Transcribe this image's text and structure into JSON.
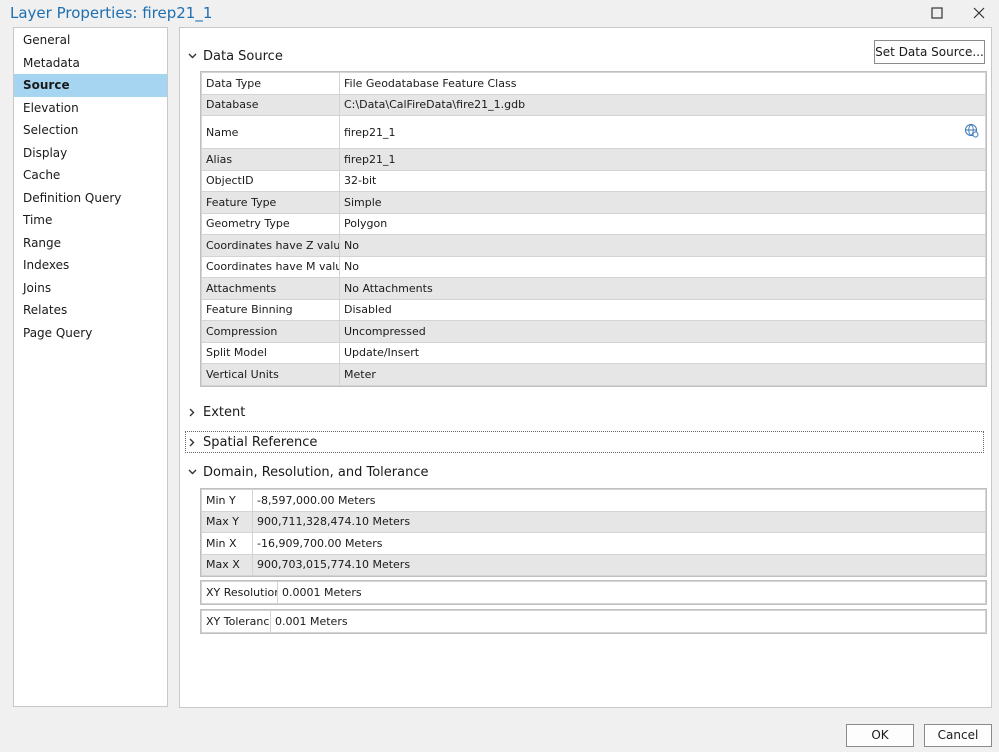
{
  "window": {
    "title": "Layer Properties: firep21_1"
  },
  "sidebar": {
    "items": [
      {
        "label": "General"
      },
      {
        "label": "Metadata"
      },
      {
        "label": "Source"
      },
      {
        "label": "Elevation"
      },
      {
        "label": "Selection"
      },
      {
        "label": "Display"
      },
      {
        "label": "Cache"
      },
      {
        "label": "Definition Query"
      },
      {
        "label": "Time"
      },
      {
        "label": "Range"
      },
      {
        "label": "Indexes"
      },
      {
        "label": "Joins"
      },
      {
        "label": "Relates"
      },
      {
        "label": "Page Query"
      }
    ],
    "active_index": 2
  },
  "data_source": {
    "title": "Data Source",
    "set_button": "Set Data Source...",
    "rows": [
      {
        "key": "Data Type",
        "value": "File Geodatabase Feature Class"
      },
      {
        "key": "Database",
        "value": "C:\\Data\\CalFireData\\fire21_1.gdb"
      },
      {
        "key": "Name",
        "value": "firep21_1"
      },
      {
        "key": "Alias",
        "value": "firep21_1"
      },
      {
        "key": "ObjectID",
        "value": "32-bit"
      },
      {
        "key": "Feature Type",
        "value": "Simple"
      },
      {
        "key": "Geometry Type",
        "value": "Polygon"
      },
      {
        "key": "Coordinates have Z value",
        "value": "No"
      },
      {
        "key": "Coordinates have M value",
        "value": "No"
      },
      {
        "key": "Attachments",
        "value": "No Attachments"
      },
      {
        "key": "Feature Binning",
        "value": "Disabled"
      },
      {
        "key": "Compression",
        "value": "Uncompressed"
      },
      {
        "key": "Split Model",
        "value": "Update/Insert"
      },
      {
        "key": "Vertical Units",
        "value": "Meter"
      }
    ]
  },
  "extent": {
    "title": "Extent"
  },
  "spatial_reference": {
    "title": "Spatial Reference"
  },
  "domain": {
    "title": "Domain, Resolution, and Tolerance",
    "rows": [
      {
        "key": "Min Y",
        "value": "-8,597,000.00 Meters"
      },
      {
        "key": "Max Y",
        "value": "900,711,328,474.10 Meters"
      },
      {
        "key": "Min X",
        "value": "-16,909,700.00 Meters"
      },
      {
        "key": "Max X",
        "value": "900,703,015,774.10 Meters"
      }
    ],
    "xy_resolution": {
      "key": "XY Resolution",
      "value": "0.0001 Meters"
    },
    "xy_tolerance": {
      "key": "XY Tolerance",
      "value": "0.001 Meters"
    }
  },
  "footer": {
    "ok": "OK",
    "cancel": "Cancel"
  }
}
